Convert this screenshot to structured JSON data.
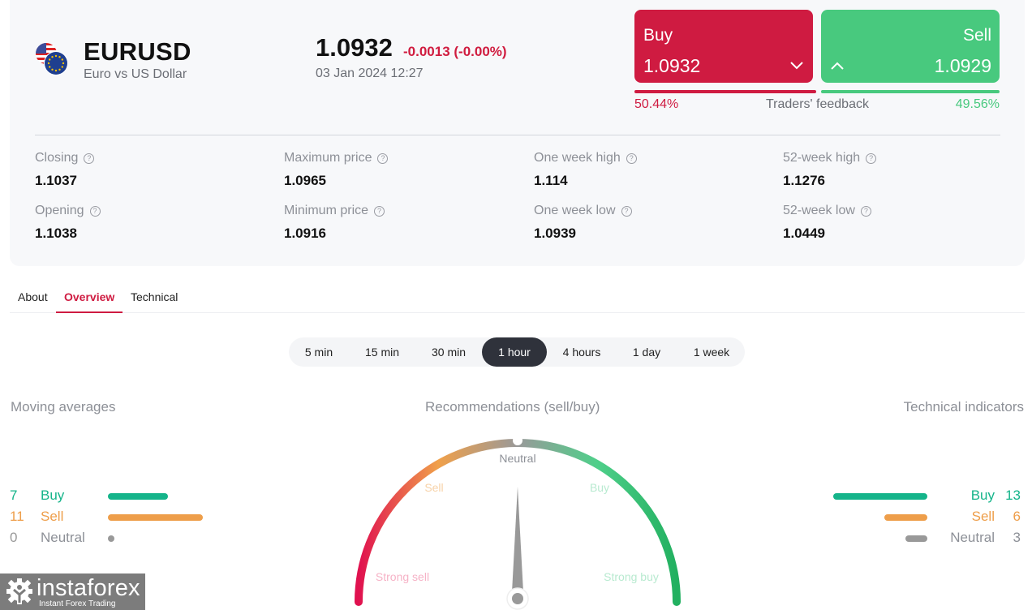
{
  "instrument": {
    "symbol": "EURUSD",
    "name": "Euro vs US Dollar",
    "price": "1.0932",
    "change": "-0.0013 (-0.00%)",
    "datetime": "03 Jan 2024 12:27",
    "flag_icon": "us-eu-flags-icon"
  },
  "trade": {
    "buy": {
      "label": "Buy",
      "value": "1.0932",
      "icon": "chevron-down-icon"
    },
    "sell": {
      "label": "Sell",
      "value": "1.0929",
      "icon": "chevron-up-icon"
    }
  },
  "feedback": {
    "label": "Traders' feedback",
    "buy_pct_text": "50.44%",
    "sell_pct_text": "49.56%",
    "buy_pct": 50.44,
    "sell_pct": 49.56
  },
  "stats": [
    {
      "label": "Closing",
      "value": "1.1037"
    },
    {
      "label": "Maximum price",
      "value": "1.0965"
    },
    {
      "label": "One week high",
      "value": "1.114"
    },
    {
      "label": "52-week high",
      "value": "1.1276"
    },
    {
      "label": "Opening",
      "value": "1.1038"
    },
    {
      "label": "Minimum price",
      "value": "1.0916"
    },
    {
      "label": "One week low",
      "value": "1.0939"
    },
    {
      "label": "52-week low",
      "value": "1.0449"
    }
  ],
  "help_icon_glyph": "?",
  "tabs": [
    {
      "label": "About",
      "active": false
    },
    {
      "label": "Overview",
      "active": true
    },
    {
      "label": "Technical",
      "active": false
    }
  ],
  "periods": [
    {
      "label": "5 min",
      "active": false
    },
    {
      "label": "15 min",
      "active": false
    },
    {
      "label": "30 min",
      "active": false
    },
    {
      "label": "1 hour",
      "active": true
    },
    {
      "label": "4 hours",
      "active": false
    },
    {
      "label": "1 day",
      "active": false
    },
    {
      "label": "1 week",
      "active": false
    }
  ],
  "moving_averages": {
    "title": "Moving averages",
    "rows": [
      {
        "count": "7",
        "label": "Buy",
        "value": 7
      },
      {
        "count": "11",
        "label": "Sell",
        "value": 11
      },
      {
        "count": "0",
        "label": "Neutral",
        "value": 0
      }
    ]
  },
  "technical_indicators": {
    "title": "Technical indicators",
    "rows": [
      {
        "count": "13",
        "label": "Buy",
        "value": 13
      },
      {
        "count": "6",
        "label": "Sell",
        "value": 6
      },
      {
        "count": "3",
        "label": "Neutral",
        "value": 3
      }
    ]
  },
  "recommendation": {
    "title": "Recommendations (sell/buy)",
    "labels": {
      "strong_sell": "Strong sell",
      "sell": "Sell",
      "neutral": "Neutral",
      "buy": "Buy",
      "strong_buy": "Strong buy"
    },
    "needle_value": 0,
    "scale_min": -1,
    "scale_max": 1,
    "current": "Neutral"
  },
  "colors": {
    "buy_red": "#cf1b41",
    "sell_green": "#48c97e",
    "indicator_buy": "#15b48a",
    "indicator_sell": "#ee9e4a",
    "indicator_neutral": "#999999"
  },
  "brand": {
    "name": "instaforex",
    "tagline": "Instant Forex Trading"
  }
}
